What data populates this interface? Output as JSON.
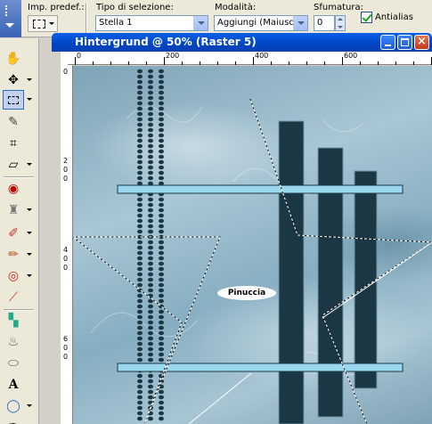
{
  "options_bar": {
    "preset_label": "Imp. predef.:",
    "selection_type_label": "Tipo di selezione:",
    "selection_type_value": "Stella 1",
    "mode_label": "Modalità:",
    "mode_value": "Aggiungi (Maiusc)",
    "feather_label": "Sfumatura:",
    "feather_value": "0",
    "antialias_label": "Antialias",
    "antialias_checked": true
  },
  "toolbar": {
    "tools": [
      "pan-tool",
      "move-tool",
      "selection-tool",
      "eyedropper-tool",
      "crop-tool",
      "deform-tool",
      "red-eye-tool",
      "clone-brush-tool",
      "paint-brush-tool",
      "retouch-tool",
      "warp-brush-tool",
      "eraser-tool",
      "color-replacer-tool",
      "flood-fill-tool",
      "picture-tube-tool",
      "text-tool",
      "preset-shape-tool",
      "pen-tool"
    ]
  },
  "image_window": {
    "title": "Hintergrund  @  50% (Raster 5)",
    "zoom": "50%",
    "ruler_top_labels": [
      "0",
      "200",
      "400",
      "600"
    ],
    "ruler_left_labels": [
      "0",
      "2",
      "0",
      "0",
      "4",
      "0",
      "0",
      "6",
      "0",
      "0"
    ],
    "watermark": "Pinuccia"
  },
  "colors": {
    "titlebar": "#0a5fe6",
    "canvas_base": "#94b6c6",
    "bars_light": "#9ad8f0",
    "bars_dark": "#1b3743"
  }
}
